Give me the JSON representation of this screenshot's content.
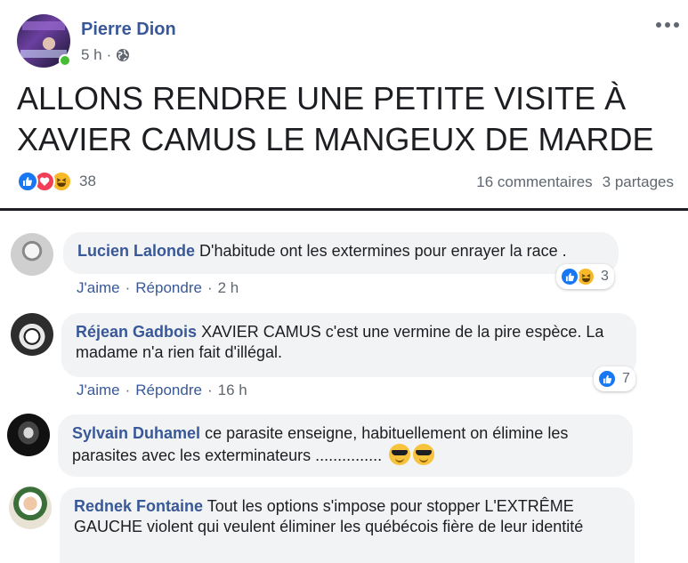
{
  "post": {
    "author": "Pierre Dion",
    "time": "5 h",
    "dot": "·",
    "text": "ALLONS RENDRE UNE PETITE VISITE À XAVIER CAMUS LE MANGEUX DE MARDE",
    "reaction_count": "38",
    "comments_count": "16 commentaires",
    "shares_count": "3 partages",
    "reactions": [
      "like-icon",
      "love-icon",
      "haha-icon"
    ]
  },
  "comments": [
    {
      "name": "Lucien Lalonde",
      "text": "D'habitude ont les extermines pour enrayer la race .",
      "like": "J'aime",
      "reply": "Répondre",
      "time": "2 h",
      "reaction_count": "3"
    },
    {
      "name": "Réjean Gadbois",
      "text": "XAVIER CAMUS c'est une vermine de la pire espèce. La madame n'a rien fait d'illégal.",
      "like": "J'aime",
      "reply": "Répondre",
      "time": "16 h",
      "reaction_count": "7"
    },
    {
      "name": "Sylvain Duhamel",
      "text": "ce parasite enseigne, habituellement on élimine les parasites avec les exterminateurs ...............",
      "emoji": "sunglasses-emoji"
    },
    {
      "name": "Rednek Fontaine",
      "text": "Tout les options s'impose pour stopper L'EXTRÊME GAUCHE violent qui veulent éliminer les québécois fière de leur identité"
    }
  ],
  "colors": {
    "link": "#385898",
    "muted": "#606770",
    "bubble": "#f2f3f5",
    "like": "#1877f2",
    "love": "#f33e58",
    "haha": "#f7b928",
    "online": "#44bd32"
  }
}
